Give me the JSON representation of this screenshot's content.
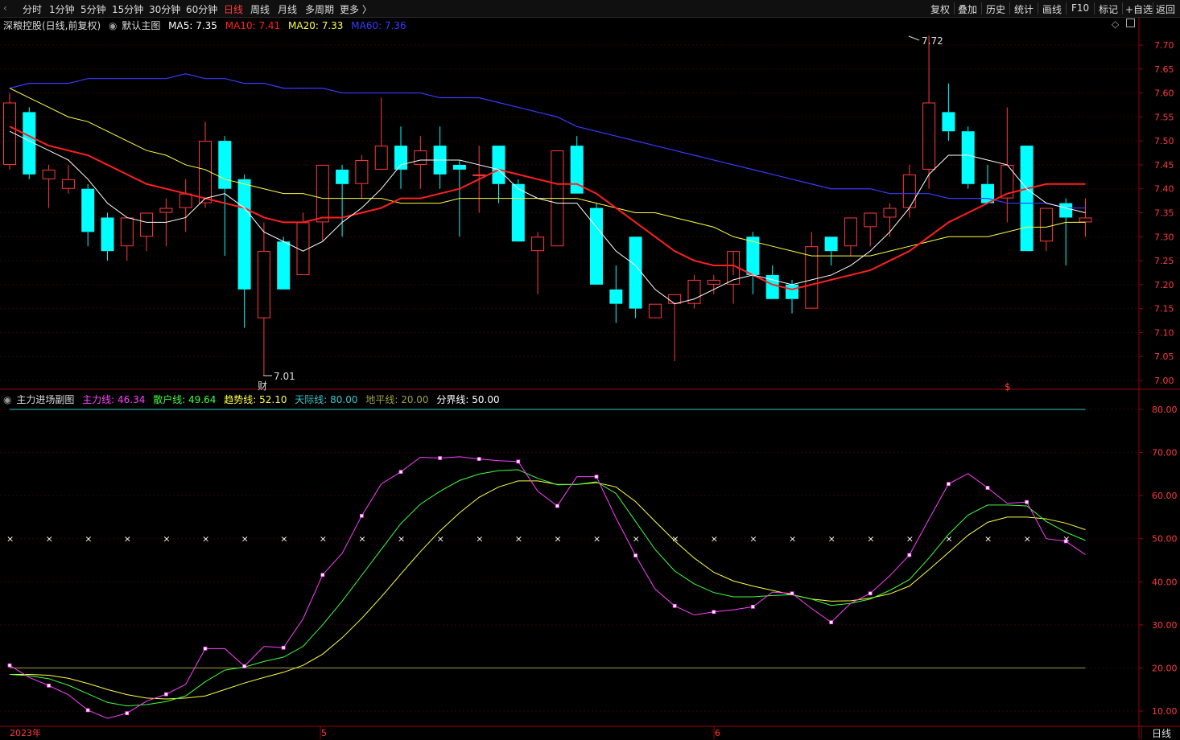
{
  "toolbar": {
    "back_arrow": "‹",
    "periods": [
      "分时",
      "1分钟",
      "5分钟",
      "15分钟",
      "30分钟",
      "60分钟",
      "日线",
      "周线",
      "月线",
      "多周期",
      "更多 〉"
    ],
    "active_period": "日线",
    "right_buttons": [
      "复权",
      "叠加",
      "历史",
      "统计",
      "画线",
      "F10",
      "标记",
      "+自选",
      "返回"
    ]
  },
  "main_legend": {
    "title": "深粮控股(日线,前复权)",
    "indicator": "默认主图",
    "items": [
      {
        "label": "MA5: 7.35",
        "color": "#ffffff"
      },
      {
        "label": "MA10: 7.41",
        "color": "#ff2020"
      },
      {
        "label": "MA20: 7.33",
        "color": "#ffff40"
      },
      {
        "label": "MA60: 7.36",
        "color": "#3a3aff"
      }
    ]
  },
  "sub_legend": {
    "title": "主力进场副图",
    "items": [
      {
        "label": "主力线: 46.34",
        "color": "#ff40ff"
      },
      {
        "label": "散户线: 49.64",
        "color": "#40ff40"
      },
      {
        "label": "趋势线: 52.10",
        "color": "#ffff40"
      },
      {
        "label": "天际线: 80.00",
        "color": "#3cc8c8"
      },
      {
        "label": "地平线: 20.00",
        "color": "#a0a040"
      },
      {
        "label": "分界线: 50.00",
        "color": "#ffffff"
      }
    ]
  },
  "annotations": {
    "high_label": "7.72",
    "low_label": "7.01",
    "fin_badge": "财",
    "dollar_badge": "$"
  },
  "time_axis": {
    "labels": [
      "2023年",
      "5",
      "6"
    ]
  },
  "bottom_right_label": "日线",
  "colors": {
    "up": "#ff3b3b",
    "down": "#00ffff",
    "axis": "#a00000",
    "grid": "#3a0000",
    "tick_text": "#ff3b3b"
  },
  "chart_data": [
    {
      "type": "candlestick",
      "title": "深粮控股(日线,前复权)",
      "y_ticks": [
        "7.70",
        "7.65",
        "7.60",
        "7.55",
        "7.50",
        "7.45",
        "7.40",
        "7.35",
        "7.30",
        "7.25",
        "7.20",
        "7.15",
        "7.10",
        "7.05",
        "7.00"
      ],
      "ylim": [
        6.98,
        7.75
      ],
      "candles": [
        {
          "o": 7.45,
          "h": 7.6,
          "l": 7.44,
          "c": 7.58
        },
        {
          "o": 7.56,
          "h": 7.57,
          "l": 7.42,
          "c": 7.43
        },
        {
          "o": 7.42,
          "h": 7.45,
          "l": 7.36,
          "c": 7.44
        },
        {
          "o": 7.4,
          "h": 7.45,
          "l": 7.39,
          "c": 7.42
        },
        {
          "o": 7.4,
          "h": 7.41,
          "l": 7.28,
          "c": 7.31
        },
        {
          "o": 7.34,
          "h": 7.35,
          "l": 7.25,
          "c": 7.27
        },
        {
          "o": 7.28,
          "h": 7.34,
          "l": 7.25,
          "c": 7.34
        },
        {
          "o": 7.3,
          "h": 7.35,
          "l": 7.27,
          "c": 7.35
        },
        {
          "o": 7.35,
          "h": 7.38,
          "l": 7.28,
          "c": 7.36
        },
        {
          "o": 7.36,
          "h": 7.42,
          "l": 7.31,
          "c": 7.39
        },
        {
          "o": 7.37,
          "h": 7.54,
          "l": 7.36,
          "c": 7.5
        },
        {
          "o": 7.5,
          "h": 7.51,
          "l": 7.26,
          "c": 7.4
        },
        {
          "o": 7.42,
          "h": 7.43,
          "l": 7.11,
          "c": 7.19
        },
        {
          "o": 7.13,
          "h": 7.33,
          "l": 7.01,
          "c": 7.27
        },
        {
          "o": 7.29,
          "h": 7.3,
          "l": 7.19,
          "c": 7.19
        },
        {
          "o": 7.22,
          "h": 7.35,
          "l": 7.22,
          "c": 7.33
        },
        {
          "o": 7.33,
          "h": 7.45,
          "l": 7.29,
          "c": 7.45
        },
        {
          "o": 7.44,
          "h": 7.45,
          "l": 7.3,
          "c": 7.41
        },
        {
          "o": 7.41,
          "h": 7.47,
          "l": 7.38,
          "c": 7.46
        },
        {
          "o": 7.44,
          "h": 7.59,
          "l": 7.44,
          "c": 7.49
        },
        {
          "o": 7.49,
          "h": 7.53,
          "l": 7.4,
          "c": 7.44
        },
        {
          "o": 7.45,
          "h": 7.51,
          "l": 7.4,
          "c": 7.48
        },
        {
          "o": 7.49,
          "h": 7.53,
          "l": 7.4,
          "c": 7.43
        },
        {
          "o": 7.45,
          "h": 7.46,
          "l": 7.3,
          "c": 7.44
        },
        {
          "o": 7.43,
          "h": 7.49,
          "l": 7.35,
          "c": 7.43
        },
        {
          "o": 7.49,
          "h": 7.49,
          "l": 7.37,
          "c": 7.41
        },
        {
          "o": 7.41,
          "h": 7.42,
          "l": 7.29,
          "c": 7.29
        },
        {
          "o": 7.27,
          "h": 7.31,
          "l": 7.18,
          "c": 7.3
        },
        {
          "o": 7.28,
          "h": 7.48,
          "l": 7.28,
          "c": 7.48
        },
        {
          "o": 7.49,
          "h": 7.51,
          "l": 7.39,
          "c": 7.39
        },
        {
          "o": 7.36,
          "h": 7.37,
          "l": 7.2,
          "c": 7.2
        },
        {
          "o": 7.19,
          "h": 7.24,
          "l": 7.12,
          "c": 7.16
        },
        {
          "o": 7.3,
          "h": 7.3,
          "l": 7.13,
          "c": 7.15
        },
        {
          "o": 7.13,
          "h": 7.16,
          "l": 7.13,
          "c": 7.16
        },
        {
          "o": 7.16,
          "h": 7.18,
          "l": 7.04,
          "c": 7.18
        },
        {
          "o": 7.16,
          "h": 7.22,
          "l": 7.15,
          "c": 7.21
        },
        {
          "o": 7.2,
          "h": 7.22,
          "l": 7.18,
          "c": 7.21
        },
        {
          "o": 7.2,
          "h": 7.22,
          "l": 7.16,
          "c": 7.27
        },
        {
          "o": 7.3,
          "h": 7.31,
          "l": 7.18,
          "c": 7.22
        },
        {
          "o": 7.22,
          "h": 7.24,
          "l": 7.18,
          "c": 7.17
        },
        {
          "o": 7.2,
          "h": 7.21,
          "l": 7.14,
          "c": 7.17
        },
        {
          "o": 7.15,
          "h": 7.31,
          "l": 7.15,
          "c": 7.28
        },
        {
          "o": 7.3,
          "h": 7.3,
          "l": 7.24,
          "c": 7.27
        },
        {
          "o": 7.28,
          "h": 7.34,
          "l": 7.26,
          "c": 7.34
        },
        {
          "o": 7.32,
          "h": 7.35,
          "l": 7.28,
          "c": 7.35
        },
        {
          "o": 7.34,
          "h": 7.37,
          "l": 7.3,
          "c": 7.36
        },
        {
          "o": 7.36,
          "h": 7.45,
          "l": 7.34,
          "c": 7.43
        },
        {
          "o": 7.44,
          "h": 7.72,
          "l": 7.4,
          "c": 7.58
        },
        {
          "o": 7.56,
          "h": 7.62,
          "l": 7.5,
          "c": 7.52
        },
        {
          "o": 7.52,
          "h": 7.53,
          "l": 7.4,
          "c": 7.41
        },
        {
          "o": 7.41,
          "h": 7.45,
          "l": 7.37,
          "c": 7.37
        },
        {
          "o": 7.38,
          "h": 7.57,
          "l": 7.33,
          "c": 7.45
        },
        {
          "o": 7.49,
          "h": 7.49,
          "l": 7.27,
          "c": 7.27
        },
        {
          "o": 7.29,
          "h": 7.36,
          "l": 7.27,
          "c": 7.36
        },
        {
          "o": 7.37,
          "h": 7.38,
          "l": 7.24,
          "c": 7.34
        },
        {
          "o": 7.33,
          "h": 7.38,
          "l": 7.3,
          "c": 7.34
        }
      ],
      "ma5": [
        7.52,
        7.5,
        7.48,
        7.46,
        7.42,
        7.37,
        7.34,
        7.33,
        7.33,
        7.34,
        7.38,
        7.39,
        7.36,
        7.31,
        7.29,
        7.27,
        7.29,
        7.33,
        7.36,
        7.4,
        7.45,
        7.46,
        7.46,
        7.46,
        7.45,
        7.44,
        7.4,
        7.38,
        7.37,
        7.37,
        7.32,
        7.27,
        7.24,
        7.19,
        7.16,
        7.17,
        7.19,
        7.21,
        7.22,
        7.21,
        7.2,
        7.21,
        7.22,
        7.24,
        7.27,
        7.31,
        7.36,
        7.43,
        7.47,
        7.47,
        7.46,
        7.45,
        7.4,
        7.37,
        7.36,
        7.35
      ],
      "ma10": [
        7.53,
        7.51,
        7.49,
        7.48,
        7.47,
        7.45,
        7.43,
        7.41,
        7.4,
        7.39,
        7.38,
        7.37,
        7.36,
        7.34,
        7.33,
        7.33,
        7.34,
        7.34,
        7.35,
        7.36,
        7.38,
        7.38,
        7.39,
        7.4,
        7.42,
        7.44,
        7.43,
        7.42,
        7.41,
        7.41,
        7.39,
        7.36,
        7.33,
        7.3,
        7.27,
        7.25,
        7.24,
        7.24,
        7.22,
        7.2,
        7.19,
        7.2,
        7.21,
        7.22,
        7.23,
        7.25,
        7.27,
        7.3,
        7.33,
        7.35,
        7.37,
        7.39,
        7.4,
        7.41,
        7.41,
        7.41
      ],
      "ma20": [
        7.61,
        7.59,
        7.57,
        7.55,
        7.54,
        7.52,
        7.5,
        7.48,
        7.47,
        7.45,
        7.44,
        7.42,
        7.41,
        7.4,
        7.39,
        7.39,
        7.38,
        7.38,
        7.38,
        7.38,
        7.37,
        7.37,
        7.37,
        7.38,
        7.38,
        7.38,
        7.38,
        7.38,
        7.38,
        7.38,
        7.37,
        7.36,
        7.35,
        7.35,
        7.34,
        7.33,
        7.32,
        7.3,
        7.29,
        7.28,
        7.27,
        7.26,
        7.26,
        7.26,
        7.26,
        7.27,
        7.28,
        7.29,
        7.3,
        7.3,
        7.3,
        7.31,
        7.32,
        7.32,
        7.33,
        7.33
      ],
      "ma60": [
        7.61,
        7.62,
        7.62,
        7.62,
        7.63,
        7.63,
        7.63,
        7.63,
        7.63,
        7.64,
        7.63,
        7.63,
        7.62,
        7.62,
        7.61,
        7.61,
        7.61,
        7.6,
        7.6,
        7.6,
        7.6,
        7.6,
        7.59,
        7.59,
        7.59,
        7.58,
        7.57,
        7.56,
        7.55,
        7.53,
        7.52,
        7.51,
        7.5,
        7.49,
        7.48,
        7.47,
        7.46,
        7.45,
        7.44,
        7.43,
        7.42,
        7.41,
        7.4,
        7.4,
        7.4,
        7.39,
        7.39,
        7.39,
        7.38,
        7.38,
        7.38,
        7.37,
        7.37,
        7.37,
        7.36,
        7.36
      ]
    },
    {
      "type": "line",
      "title": "主力进场副图",
      "y_ticks": [
        "80.00",
        "70.00",
        "60.00",
        "50.00",
        "40.00",
        "30.00",
        "20.00",
        "10.00"
      ],
      "ylim": [
        6.5,
        82.5
      ],
      "series": [
        {
          "name": "主力线",
          "color": "#ff40ff",
          "marker_every": 2,
          "values": [
            20.6,
            17.8,
            15.9,
            13.8,
            10.2,
            8.3,
            9.5,
            12.3,
            13.9,
            16.2,
            24.5,
            24.5,
            20.4,
            25.0,
            24.7,
            31.4,
            41.6,
            46.6,
            55.3,
            62.7,
            65.5,
            68.9,
            68.7,
            69.0,
            68.5,
            68.1,
            67.9,
            61.0,
            57.6,
            64.4,
            64.4,
            54.8,
            46.1,
            38.3,
            34.4,
            32.3,
            33.0,
            33.5,
            34.2,
            37.6,
            37.3,
            33.8,
            30.6,
            35.0,
            37.3,
            41.4,
            46.2,
            54.5,
            62.7,
            65.1,
            61.8,
            58.2,
            58.5,
            50.0,
            49.4,
            46.3
          ]
        },
        {
          "name": "散户线",
          "color": "#40ff40",
          "values": [
            18.5,
            18.2,
            17.5,
            16.0,
            14.0,
            12.0,
            11.2,
            11.5,
            12.2,
            13.5,
            16.8,
            19.5,
            20.2,
            21.5,
            22.5,
            25.0,
            30.0,
            35.5,
            41.5,
            47.5,
            53.5,
            58.0,
            61.0,
            63.5,
            65.0,
            65.8,
            66.0,
            64.0,
            62.5,
            62.6,
            63.2,
            60.5,
            54.0,
            47.5,
            42.5,
            39.5,
            37.5,
            36.5,
            36.5,
            36.8,
            37.0,
            36.0,
            34.5,
            35.0,
            36.0,
            38.0,
            40.5,
            45.5,
            51.0,
            55.5,
            57.8,
            57.8,
            57.6,
            54.0,
            51.5,
            49.6
          ]
        },
        {
          "name": "趋势线",
          "color": "#ffff40",
          "values": [
            18.5,
            18.5,
            18.3,
            17.6,
            16.4,
            15.0,
            13.8,
            13.0,
            12.8,
            13.0,
            13.5,
            15.0,
            16.5,
            17.8,
            19.0,
            20.6,
            23.2,
            27.0,
            31.5,
            36.5,
            41.8,
            47.0,
            51.8,
            56.0,
            59.6,
            62.0,
            63.4,
            63.4,
            62.6,
            62.6,
            63.0,
            62.0,
            58.6,
            54.0,
            49.5,
            45.5,
            42.2,
            40.2,
            39.0,
            38.0,
            37.0,
            36.0,
            35.5,
            35.6,
            36.2,
            37.2,
            39.0,
            42.8,
            46.8,
            50.8,
            53.8,
            55.0,
            55.0,
            54.6,
            53.6,
            52.1
          ]
        }
      ],
      "reference_lines": [
        {
          "name": "天际线",
          "value": 80,
          "color": "#3cc8c8"
        },
        {
          "name": "地平线",
          "value": 20,
          "color": "#a0a040"
        },
        {
          "name": "分界线",
          "value": 50,
          "color": "#ffffff",
          "marker": "x"
        }
      ]
    }
  ]
}
